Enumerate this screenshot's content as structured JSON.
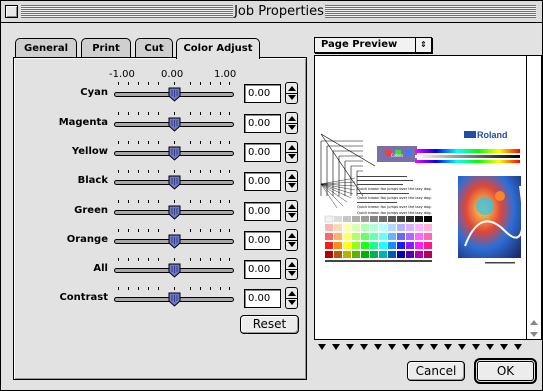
{
  "window": {
    "title": "Job Properties"
  },
  "tabs": [
    {
      "label": "General",
      "active": false
    },
    {
      "label": "Print",
      "active": false
    },
    {
      "label": "Cut",
      "active": false
    },
    {
      "label": "Color Adjust",
      "active": true
    }
  ],
  "scale": {
    "min": "-1.00",
    "mid": "0.00",
    "max": "1.00"
  },
  "sliders": [
    {
      "label": "Cyan",
      "value": "0.00",
      "level": 0.0
    },
    {
      "label": "Magenta",
      "value": "0.00",
      "level": 0.0
    },
    {
      "label": "Yellow",
      "value": "0.00",
      "level": 0.0
    },
    {
      "label": "Black",
      "value": "0.00",
      "level": 0.0
    },
    {
      "label": "Green",
      "value": "0.00",
      "level": 0.0
    },
    {
      "label": "Orange",
      "value": "0.00",
      "level": 0.0
    },
    {
      "label": "All",
      "value": "0.00",
      "level": 0.0
    },
    {
      "label": "Contrast",
      "value": "0.00",
      "level": 0.0
    }
  ],
  "buttons": {
    "reset": "Reset",
    "cancel": "Cancel",
    "ok": "OK"
  },
  "preview": {
    "selector": "Page Preview",
    "brand": "Roland",
    "swatch_caption": "Colors",
    "text_lines": [
      "Quick brown fox jumps over the lazy dog.",
      "Quick brown fox jumps over the lazy dog.",
      "Quick brown fox jumps over the lazy dog.",
      "Quick brown fox jumps over the lazy dog."
    ]
  },
  "colors": {
    "thumb": "#6f79c8",
    "accent": "#1f4ea8"
  }
}
